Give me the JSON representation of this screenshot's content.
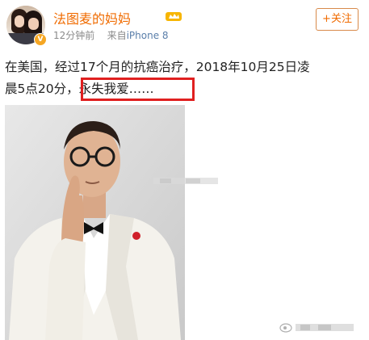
{
  "post": {
    "author": {
      "name": "法图麦的妈妈",
      "verified_badge_icon": "verified-v-icon",
      "vip_badge_icon": "vip-crown-icon"
    },
    "meta": {
      "time": "12分钟前",
      "source_prefix": "来自",
      "device": "iPhone 8"
    },
    "follow_button": {
      "label": "+关注"
    },
    "content": {
      "line1": "在美国，经过17个月的抗癌治疗，2018年10月25日凌",
      "line2_prefix": "晨5点20分，",
      "line2_highlight": "永失我爱……"
    },
    "image": {
      "icon": "portrait-photo"
    },
    "watermark_icon": "weibo-watermark-icon"
  },
  "colors": {
    "accent": "#f06b00",
    "highlight_border": "#e02020",
    "meta_text": "#8a8a8a",
    "device_link": "#5b7faa"
  }
}
